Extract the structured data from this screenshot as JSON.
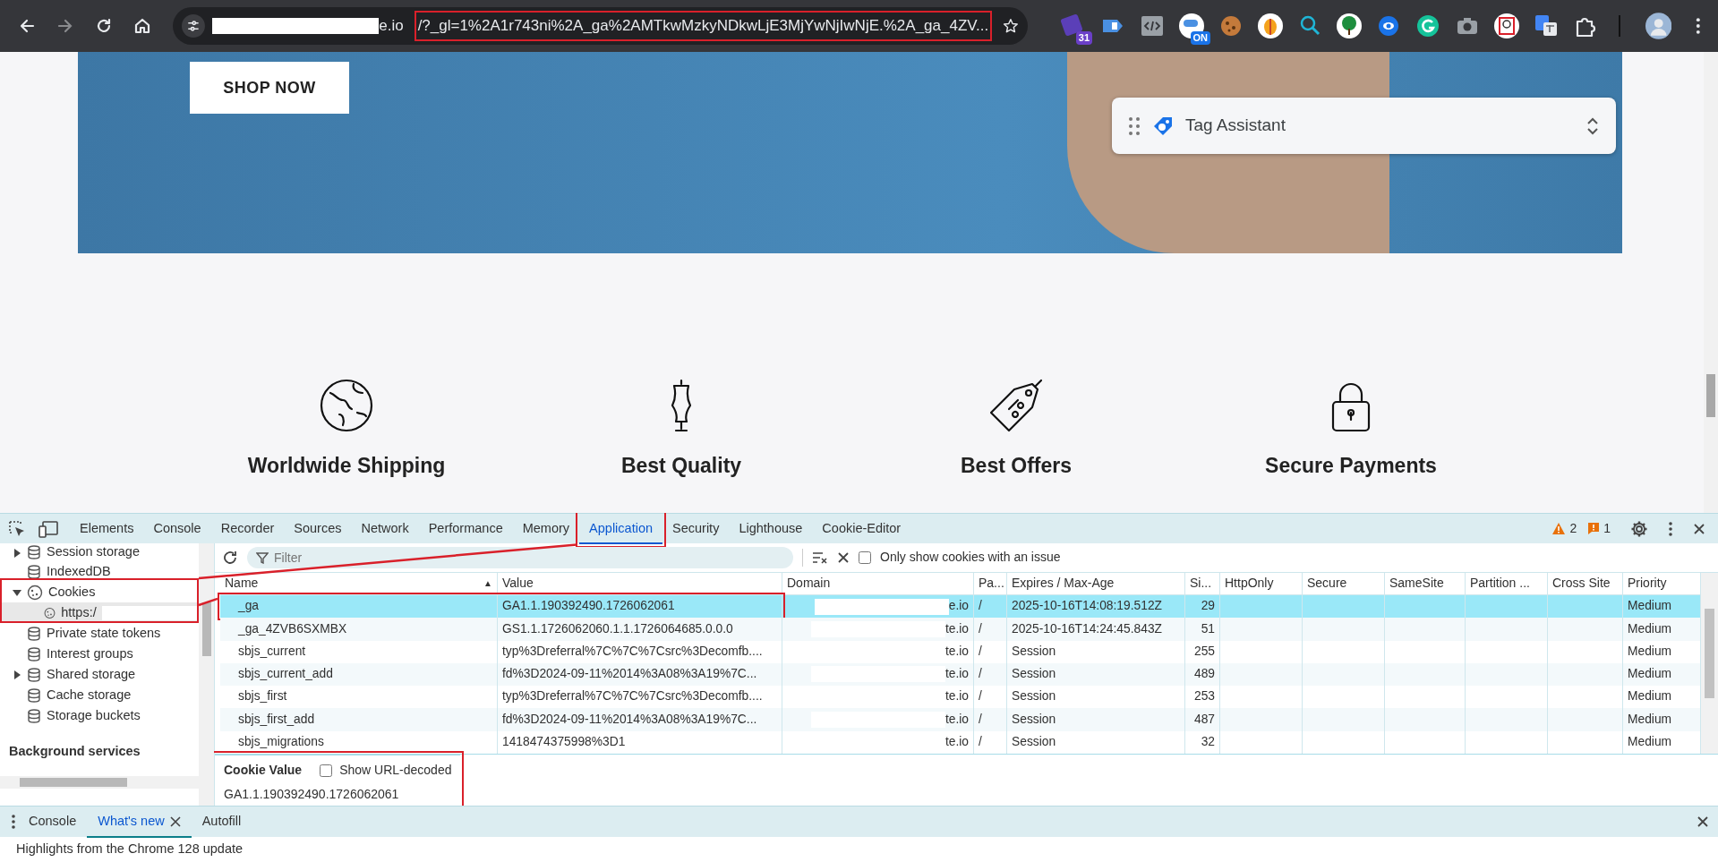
{
  "browser": {
    "url": {
      "host_tail": "e.io",
      "query": "/?_gl=1%2A1r743ni%2A_ga%2AMTkwMzkyNDkwLjE3MjYwNjIwNjE.%2A_ga_4ZV...",
      "highlighted": true
    },
    "extensions": [
      {
        "kind": "calendar",
        "badge": "31"
      },
      {
        "kind": "tag"
      },
      {
        "kind": "code"
      },
      {
        "kind": "switch",
        "badge": "ON"
      },
      {
        "kind": "cookie"
      },
      {
        "kind": "fruit"
      },
      {
        "kind": "magnifier"
      },
      {
        "kind": "tree"
      },
      {
        "kind": "eye"
      },
      {
        "kind": "grammar"
      },
      {
        "kind": "camera"
      },
      {
        "kind": "portrait"
      },
      {
        "kind": "translate"
      },
      {
        "kind": "puzzle"
      }
    ]
  },
  "page": {
    "hero": {
      "button": "SHOP NOW"
    },
    "tag_assistant": {
      "title": "Tag Assistant"
    },
    "features": [
      {
        "kind": "globe",
        "label": "Worldwide Shipping"
      },
      {
        "kind": "dress-form",
        "label": "Best Quality"
      },
      {
        "kind": "tag",
        "label": "Best Offers"
      },
      {
        "kind": "padlock",
        "label": "Secure Payments"
      }
    ]
  },
  "devtools": {
    "tabs": [
      {
        "label": "Elements",
        "selected": false,
        "highlighted": false
      },
      {
        "label": "Console",
        "selected": false,
        "highlighted": false
      },
      {
        "label": "Recorder",
        "selected": false,
        "highlighted": false
      },
      {
        "label": "Sources",
        "selected": false,
        "highlighted": false
      },
      {
        "label": "Network",
        "selected": false,
        "highlighted": false
      },
      {
        "label": "Performance",
        "selected": false,
        "highlighted": false
      },
      {
        "label": "Memory",
        "selected": false,
        "highlighted": false
      },
      {
        "label": "Application",
        "selected": true,
        "highlighted": true
      },
      {
        "label": "Security",
        "selected": false,
        "highlighted": false
      },
      {
        "label": "Lighthouse",
        "selected": false,
        "highlighted": false
      },
      {
        "label": "Cookie-Editor",
        "selected": false,
        "highlighted": false
      }
    ],
    "warnings": "2",
    "issues": "1",
    "sidebar": {
      "items": [
        {
          "label": "Session storage",
          "expanded": false,
          "selected": false,
          "highlighted": false
        },
        {
          "label": "IndexedDB",
          "selected": false,
          "highlighted": false
        },
        {
          "label": "Cookies",
          "expanded": true,
          "selected": false,
          "highlighted": true,
          "children": [
            {
              "label": "https:/",
              "selected": true,
              "highlighted": false
            }
          ]
        },
        {
          "label": "Private state tokens",
          "selected": false,
          "highlighted": false
        },
        {
          "label": "Interest groups",
          "selected": false,
          "highlighted": false
        },
        {
          "label": "Shared storage",
          "expanded": false,
          "selected": false,
          "highlighted": false
        },
        {
          "label": "Cache storage",
          "selected": false,
          "highlighted": false
        },
        {
          "label": "Storage buckets",
          "selected": false,
          "highlighted": false
        }
      ],
      "section": "Background services"
    },
    "toolbar": {
      "filter_placeholder": "Filter",
      "issue_only": {
        "label": "Only show cookies with an issue",
        "checked": false
      }
    },
    "cookies": {
      "columns": [
        {
          "label": "Name",
          "sort_mark": "▲"
        },
        {
          "label": "Value"
        },
        {
          "label": "Domain"
        },
        {
          "label": "Pa..."
        },
        {
          "label": "Expires / Max-Age"
        },
        {
          "label": "Si..."
        },
        {
          "label": "HttpOnly"
        },
        {
          "label": "Secure"
        },
        {
          "label": "SameSite"
        },
        {
          "label": "Partition ..."
        },
        {
          "label": "Cross Site"
        },
        {
          "label": "Priority"
        }
      ],
      "rows": [
        {
          "name": "_ga",
          "value": "GA1.1.190392490.1726062061",
          "domain": "e.io",
          "path": "/",
          "expires": "2025-10-16T14:08:19.512Z",
          "size": "29",
          "priority": "Medium",
          "selected": true,
          "highlighted": true
        },
        {
          "name": "_ga_4ZVB6SXMBX",
          "value": "GS1.1.1726062060.1.1.1726064685.0.0.0",
          "domain": "te.io",
          "path": "/",
          "expires": "2025-10-16T14:24:45.843Z",
          "size": "51",
          "priority": "Medium",
          "selected": false,
          "highlighted": false
        },
        {
          "name": "sbjs_current",
          "value": "typ%3Dreferral%7C%7C%7Csrc%3Decomfb....",
          "domain": "te.io",
          "path": "/",
          "expires": "Session",
          "size": "255",
          "priority": "Medium",
          "selected": false,
          "highlighted": false
        },
        {
          "name": "sbjs_current_add",
          "value": "fd%3D2024-09-11%2014%3A08%3A19%7C...",
          "domain": "te.io",
          "path": "/",
          "expires": "Session",
          "size": "489",
          "priority": "Medium",
          "selected": false,
          "highlighted": false
        },
        {
          "name": "sbjs_first",
          "value": "typ%3Dreferral%7C%7C%7Csrc%3Decomfb....",
          "domain": "te.io",
          "path": "/",
          "expires": "Session",
          "size": "253",
          "priority": "Medium",
          "selected": false,
          "highlighted": false
        },
        {
          "name": "sbjs_first_add",
          "value": "fd%3D2024-09-11%2014%3A08%3A19%7C...",
          "domain": "te.io",
          "path": "/",
          "expires": "Session",
          "size": "487",
          "priority": "Medium",
          "selected": false,
          "highlighted": false
        },
        {
          "name": "sbjs_migrations",
          "value": "1418474375998%3D1",
          "domain": "te.io",
          "path": "/",
          "expires": "Session",
          "size": "32",
          "priority": "Medium",
          "selected": false,
          "highlighted": false
        }
      ]
    },
    "cookie_value": {
      "title": "Cookie Value",
      "url_decoded": {
        "label": "Show URL-decoded",
        "checked": false
      },
      "value": "GA1.1.190392490.1726062061",
      "highlighted": true
    },
    "drawer": {
      "tabs": [
        {
          "label": "Console",
          "selected": false,
          "closable": false
        },
        {
          "label": "What's new",
          "selected": true,
          "closable": true
        },
        {
          "label": "Autofill",
          "selected": false,
          "closable": false
        }
      ],
      "message": "Highlights from the Chrome 128 update"
    }
  }
}
